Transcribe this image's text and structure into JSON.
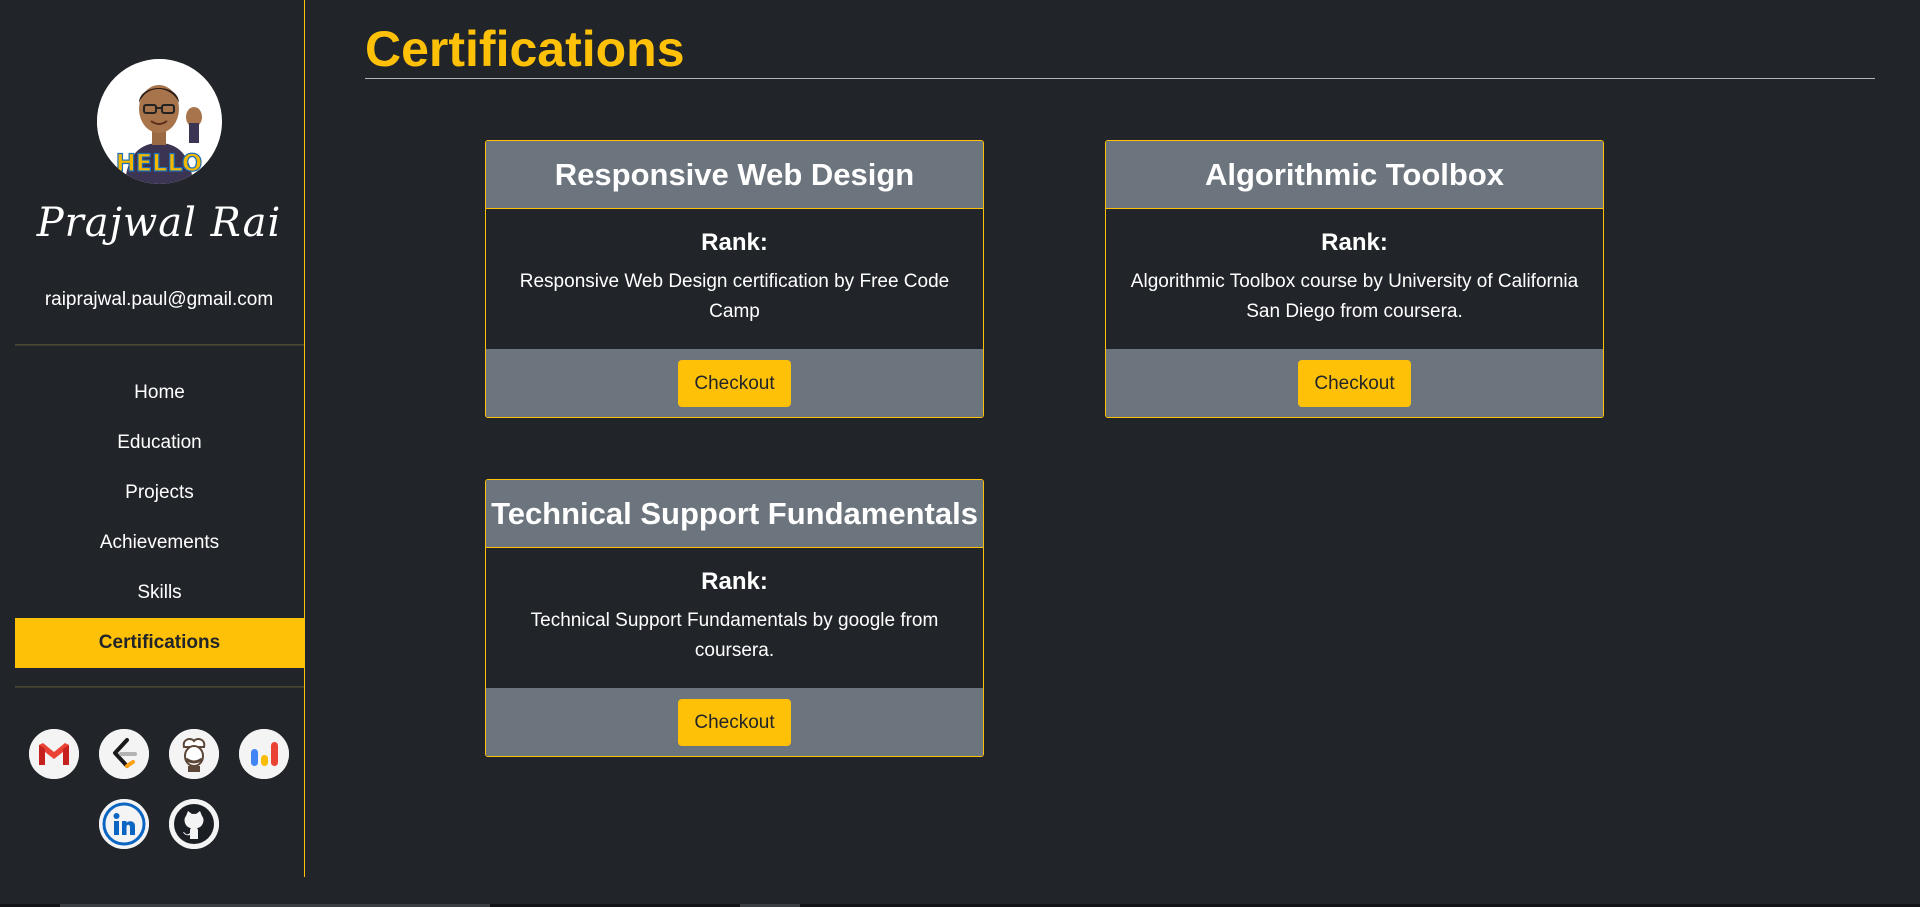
{
  "profile": {
    "name": "Prajwal Rai",
    "email": "raiprajwal.paul@gmail.com",
    "avatar_text": "HELLO"
  },
  "nav": {
    "items": [
      {
        "label": "Home"
      },
      {
        "label": "Education"
      },
      {
        "label": "Projects"
      },
      {
        "label": "Achievements"
      },
      {
        "label": "Skills"
      },
      {
        "label": "Certifications"
      }
    ],
    "active": "Certifications"
  },
  "social": [
    {
      "icon": "gmail-icon"
    },
    {
      "icon": "leetcode-icon"
    },
    {
      "icon": "codechef-icon"
    },
    {
      "icon": "google-analytics-icon"
    },
    {
      "icon": "linkedin-icon"
    },
    {
      "icon": "github-icon"
    }
  ],
  "page": {
    "title": "Certifications"
  },
  "certifications": [
    {
      "title": "Responsive Web Design",
      "rank_label": "Rank:",
      "description": "Responsive Web Design certification by Free Code Camp",
      "button": "Checkout"
    },
    {
      "title": "Algorithmic Toolbox",
      "rank_label": "Rank:",
      "description": "Algorithmic Toolbox course by University of California San Diego from coursera.",
      "button": "Checkout"
    },
    {
      "title": "Technical Support Fundamentals",
      "rank_label": "Rank:",
      "description": "Technical Support Fundamentals by google from coursera.",
      "button": "Checkout"
    }
  ],
  "colors": {
    "accent": "#ffc107",
    "background": "#212529",
    "card_header": "#6c757d"
  }
}
